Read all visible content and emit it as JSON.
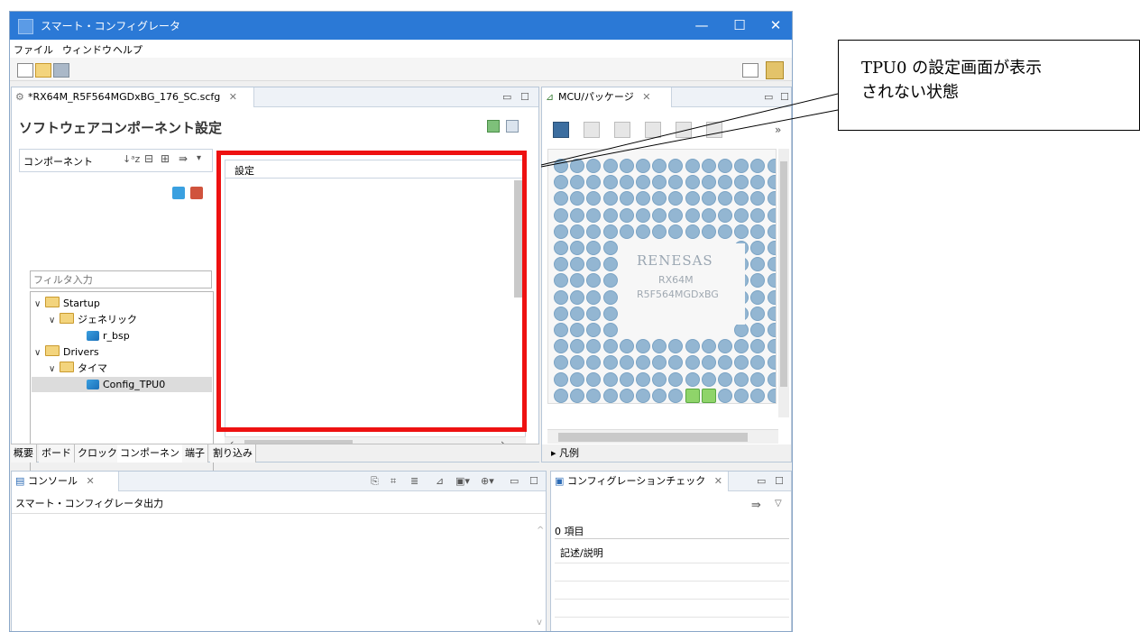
{
  "window": {
    "title": "スマート・コンフィグレータ",
    "controls": [
      "—",
      "☐",
      "✕"
    ]
  },
  "menu": [
    "ファイル",
    "ウィンドウ",
    "ヘルプ"
  ],
  "editor": {
    "tab_label": "*RX64M_R5F564MGDxBG_176_SC.scfg",
    "heading": "ソフトウェアコンポーネント設定",
    "component_label": "コンポーネント",
    "filter_placeholder": "フィルタ入力",
    "settings_label": "設定",
    "tree": [
      {
        "label": "Startup",
        "level": 0,
        "type": "folder"
      },
      {
        "label": "ジェネリック",
        "level": 1,
        "type": "folder"
      },
      {
        "label": "r_bsp",
        "level": 2,
        "type": "component"
      },
      {
        "label": "Drivers",
        "level": 0,
        "type": "folder"
      },
      {
        "label": "タイマ",
        "level": 1,
        "type": "folder"
      },
      {
        "label": "Config_TPU0",
        "level": 2,
        "type": "component",
        "selected": true
      }
    ],
    "bottom_tabs": [
      "概要",
      "ボード",
      "クロック",
      "コンポーネント",
      "端子",
      "割り込み"
    ],
    "active_bottom_tab": "コンポーネント"
  },
  "mcu": {
    "tab_label": "MCU/パッケージ",
    "chip_brand": "RENESAS",
    "chip_model": "RX64M",
    "chip_part": "R5F564MGDxBG",
    "legend_label": "▸ 凡例"
  },
  "console": {
    "tab_label": "コンソール",
    "output_label": "スマート・コンフィグレータ出力"
  },
  "config_check": {
    "tab_label": "コンフィグレーションチェック",
    "count_label": "0 項目",
    "column_label": "記述/説明"
  },
  "annotation": {
    "line1": "TPU0 の設定画面が表示",
    "line2": "されない状態"
  },
  "colors": {
    "highlight": "#ee1111",
    "titlebar": "#2b79d6",
    "pin": "#93b6d2",
    "pin_active": "#8fd46a"
  }
}
